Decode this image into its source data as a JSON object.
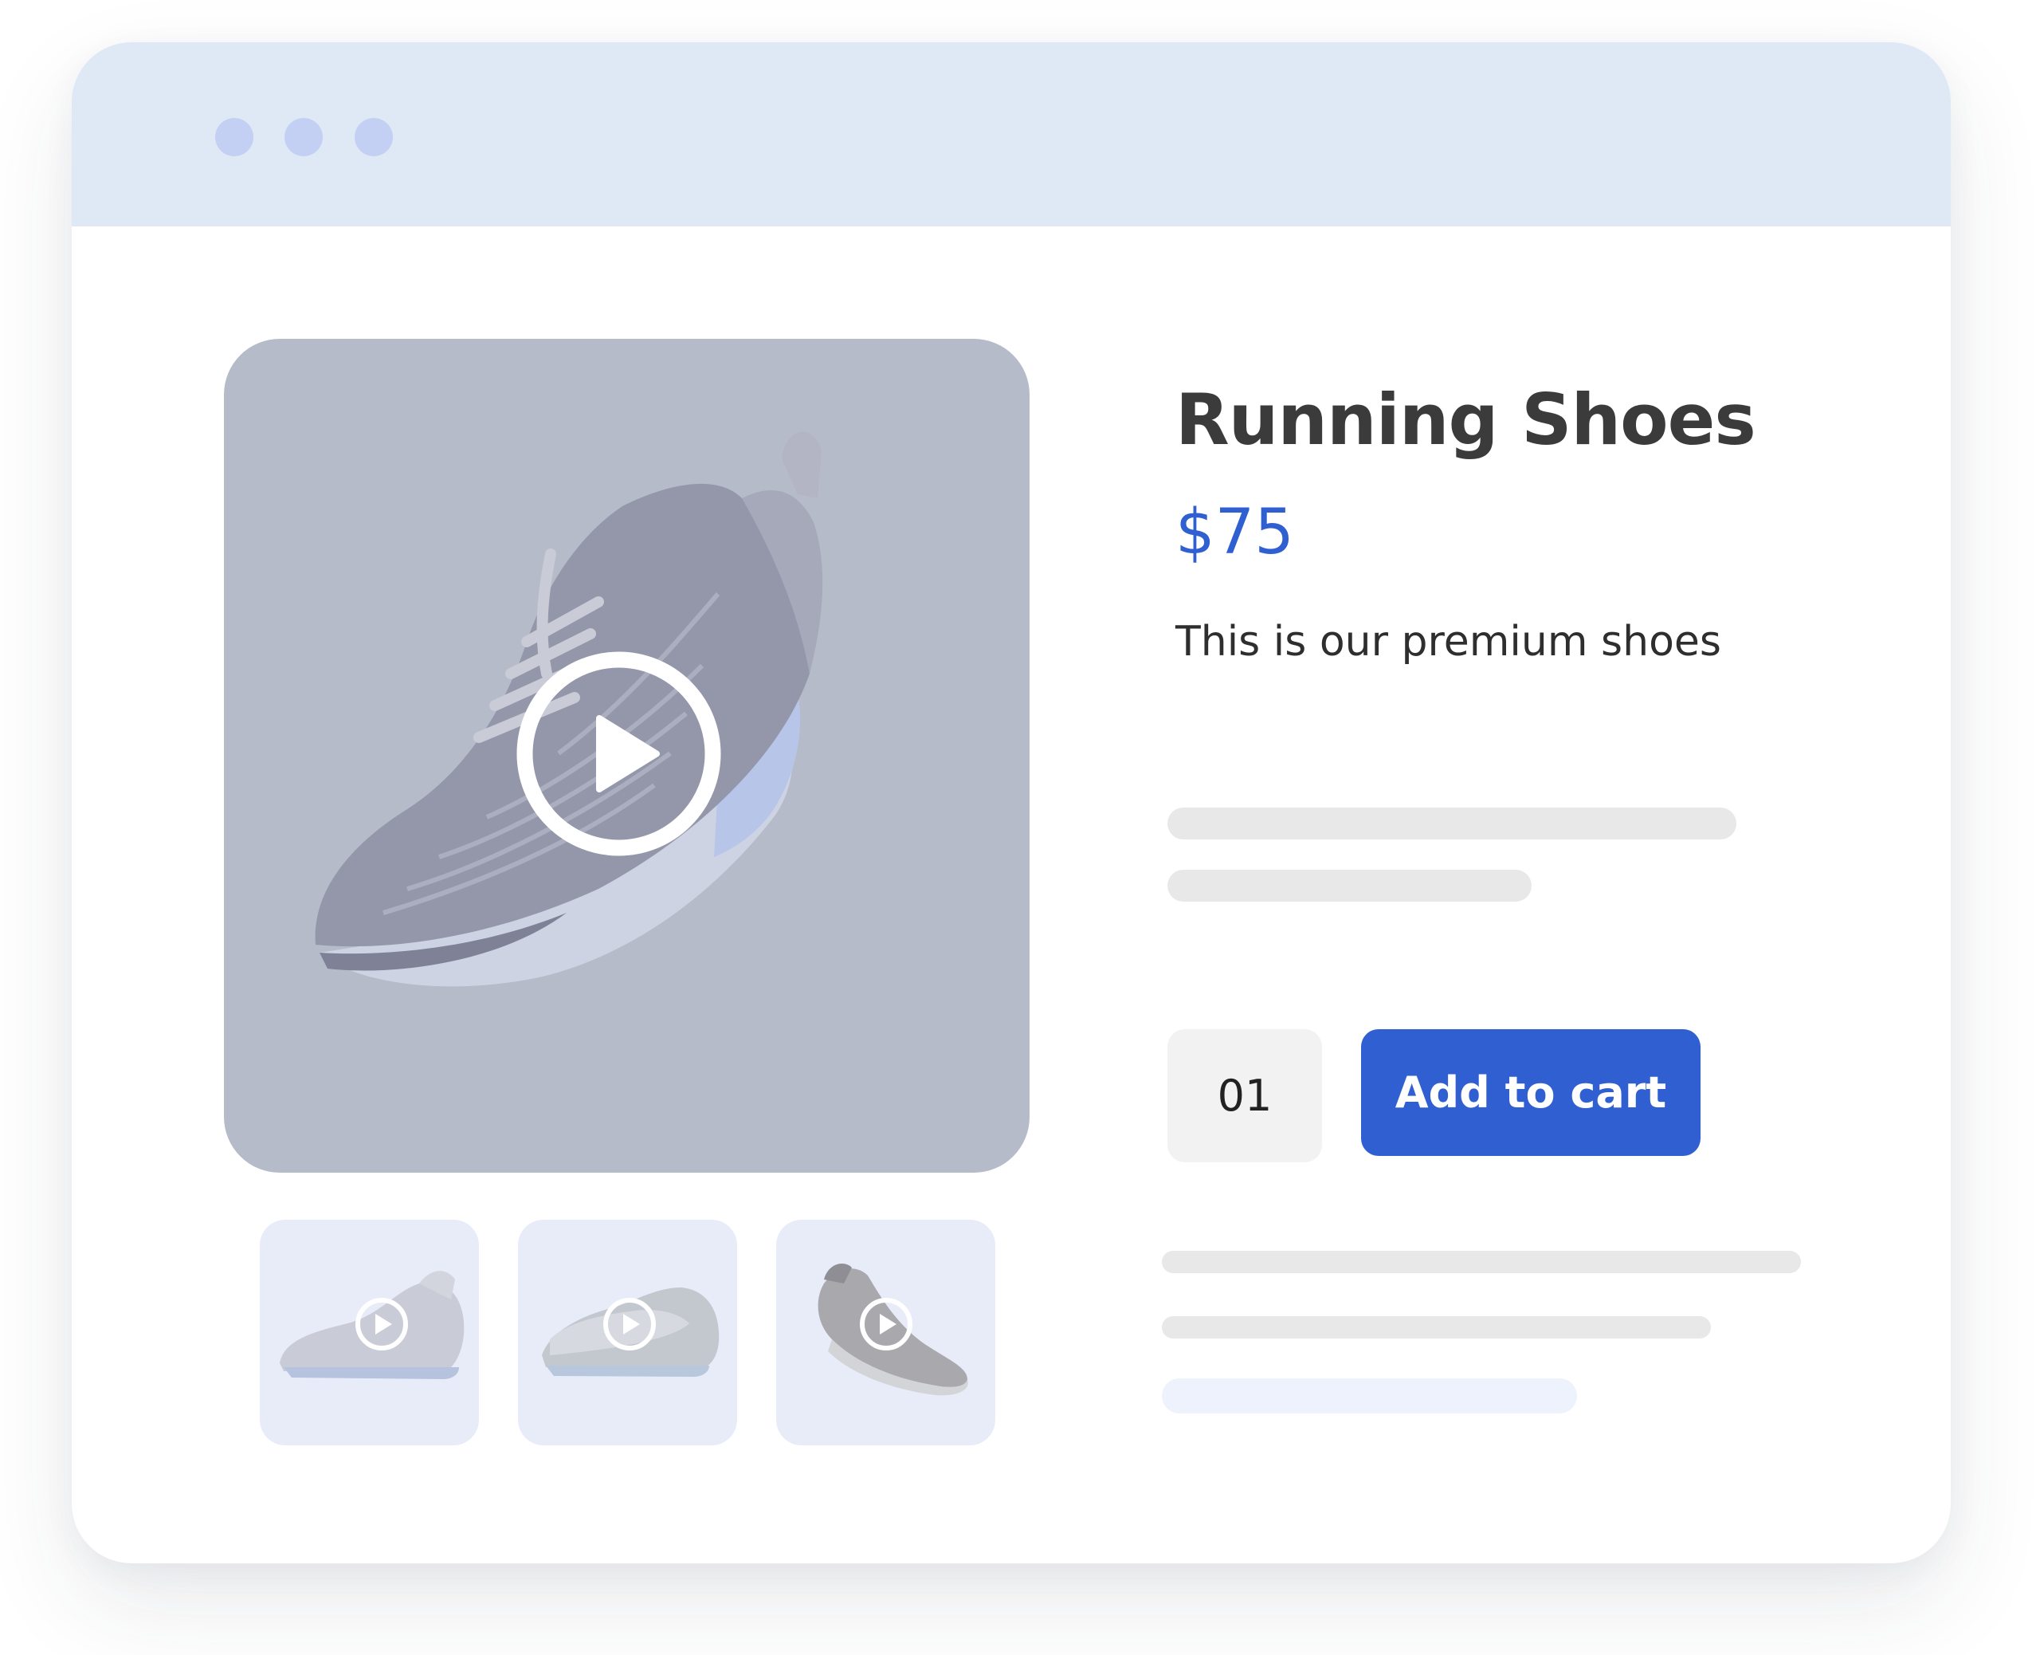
{
  "window": {
    "controls": [
      "dot",
      "dot",
      "dot"
    ]
  },
  "product": {
    "title": "Running Shoes",
    "price": "$75",
    "description": "This is our premium shoes"
  },
  "media": {
    "main_icon": "play-icon",
    "thumbnails": [
      {
        "icon": "play-icon",
        "image": "sneaker-side-view"
      },
      {
        "icon": "play-icon",
        "image": "sneaker-pair"
      },
      {
        "icon": "play-icon",
        "image": "sneaker-angled"
      }
    ]
  },
  "cart": {
    "quantity": "01",
    "add_label": "Add to cart"
  },
  "colors": {
    "accent": "#2f5fd1",
    "titlebar": "#dfe8f5",
    "window_dots": "#c3d0f3",
    "media_bg": "#b5bbc9",
    "thumb_bg": "#e8ecf9",
    "skeleton": "#e8e8e8"
  }
}
